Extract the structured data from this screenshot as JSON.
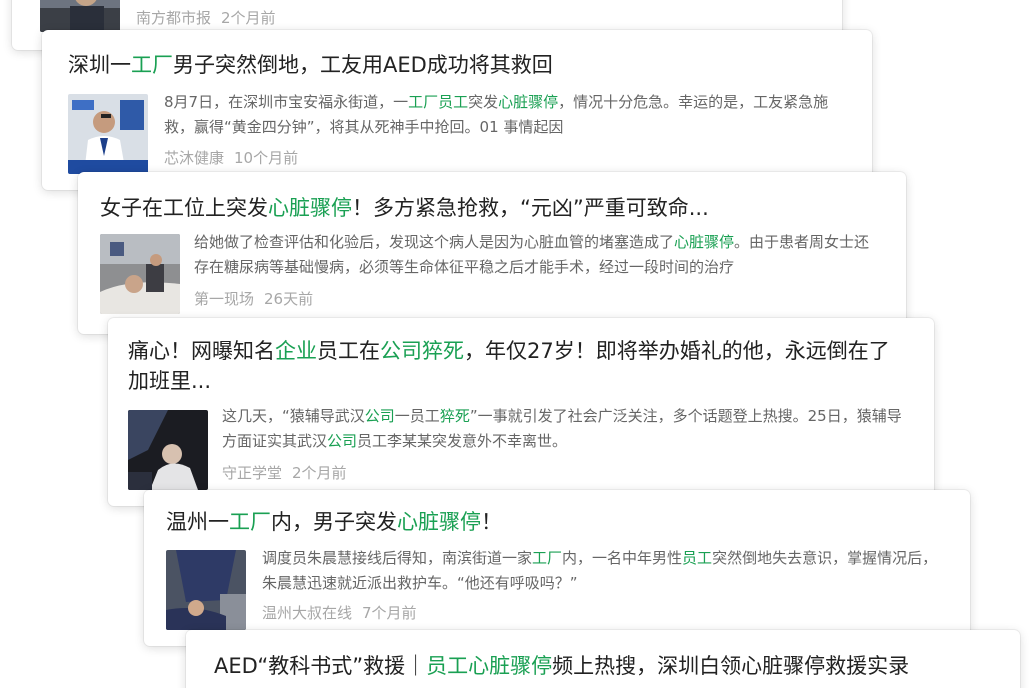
{
  "results": [
    {
      "title": [],
      "summary": [],
      "source": "南方都市报",
      "time": "2个月前"
    },
    {
      "title": [
        {
          "t": "深圳一"
        },
        {
          "t": "工厂",
          "hl": true
        },
        {
          "t": "男子突然倒地，工友用AED成功将其救回"
        }
      ],
      "summary": [
        {
          "t": "8月7日，在深圳市宝安福永街道，一"
        },
        {
          "t": "工厂员工",
          "hl": true
        },
        {
          "t": "突发"
        },
        {
          "t": "心脏骤停",
          "hl": true
        },
        {
          "t": "，情况十分危急。幸运的是，工友紧急施救，赢得“黄金四分钟”，将其从死神手中抢回。01 事情起因"
        }
      ],
      "source": "芯沐健康",
      "time": "10个月前"
    },
    {
      "title": [
        {
          "t": "女子在工位上突发"
        },
        {
          "t": "心脏骤停",
          "hl": true
        },
        {
          "t": "！多方紧急抢救，“元凶”严重可致命..."
        }
      ],
      "summary": [
        {
          "t": "给她做了检查评估和化验后，发现这个病人是因为心脏血管的堵塞造成了"
        },
        {
          "t": "心脏骤停",
          "hl": true
        },
        {
          "t": "。由于患者周女士还存在糖尿病等基础慢病，必须等生命体征平稳之后才能手术，经过一段时间的治疗"
        }
      ],
      "source": "第一现场",
      "time": "26天前"
    },
    {
      "title": [
        {
          "t": "痛心！网曝知名"
        },
        {
          "t": "企业",
          "hl": true
        },
        {
          "t": "员工在"
        },
        {
          "t": "公司猝死",
          "hl": true
        },
        {
          "t": "，年仅27岁！即将举办婚礼的他，永远倒在了加班里..."
        }
      ],
      "summary": [
        {
          "t": "这几天，“猿辅导武汉"
        },
        {
          "t": "公司",
          "hl": true
        },
        {
          "t": "一员工"
        },
        {
          "t": "猝死",
          "hl": true
        },
        {
          "t": "”一事就引发了社会广泛关注，多个话题登上热搜。25日，猿辅导方面证实其武汉"
        },
        {
          "t": "公司",
          "hl": true
        },
        {
          "t": "员工李某某突发意外不幸离世。"
        }
      ],
      "source": "守正学堂",
      "time": "2个月前"
    },
    {
      "title": [
        {
          "t": "温州一"
        },
        {
          "t": "工厂",
          "hl": true
        },
        {
          "t": "内，男子突发"
        },
        {
          "t": "心脏骤停",
          "hl": true
        },
        {
          "t": "！"
        }
      ],
      "summary": [
        {
          "t": "调度员朱晨慧接线后得知，南滨街道一家"
        },
        {
          "t": "工厂",
          "hl": true
        },
        {
          "t": "内，一名中年男性"
        },
        {
          "t": "员工",
          "hl": true
        },
        {
          "t": "突然倒地失去意识，掌握情况后，朱晨慧迅速就近派出救护车。“他还有呼吸吗？”"
        }
      ],
      "source": "温州大叔在线",
      "time": "7个月前"
    },
    {
      "title": [
        {
          "t": "AED“教科书式”救援｜"
        },
        {
          "t": "员工心脏骤停",
          "hl": true
        },
        {
          "t": "频上热搜，深圳白领心脏骤停救援实录"
        }
      ],
      "summary": [],
      "source": "",
      "time": ""
    }
  ],
  "colors": {
    "highlight": "#1aa053",
    "title": "#222222",
    "summary": "#666666",
    "meta": "#a7a7a7"
  }
}
